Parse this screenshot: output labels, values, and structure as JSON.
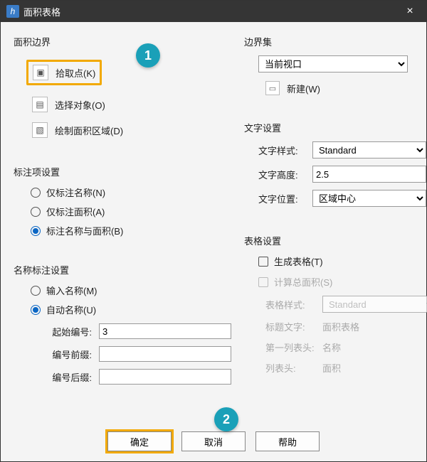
{
  "title": "面积表格",
  "callouts": {
    "one": "1",
    "two": "2"
  },
  "left": {
    "boundary": {
      "title": "面积边界",
      "pick_point": "拾取点(K)",
      "select_obj": "选择对象(O)",
      "draw_region": "绘制面积区域(D)"
    },
    "annot_item": {
      "title": "标注项设置",
      "only_name": "仅标注名称(N)",
      "only_area": "仅标注面积(A)",
      "both": "标注名称与面积(B)"
    },
    "name_annot": {
      "title": "名称标注设置",
      "input_name": "输入名称(M)",
      "auto_name": "自动名称(U)",
      "start_no_label": "起始编号:",
      "start_no_value": "3",
      "prefix_label": "编号前缀:",
      "prefix_value": "",
      "suffix_label": "编号后缀:",
      "suffix_value": ""
    }
  },
  "right": {
    "bset": {
      "title": "边界集",
      "current_viewport": "当前视口",
      "new_btn": "新建(W)"
    },
    "text": {
      "title": "文字设置",
      "style_label": "文字样式:",
      "style_value": "Standard",
      "height_label": "文字高度:",
      "height_value": "2.5",
      "pos_label": "文字位置:",
      "pos_value": "区域中心"
    },
    "table": {
      "title": "表格设置",
      "gen_table": "生成表格(T)",
      "calc_total": "计算总面积(S)",
      "style_label": "表格样式:",
      "style_value": "Standard",
      "title_label": "标题文字:",
      "title_value": "面积表格",
      "col1_label": "第一列表头:",
      "col1_value": "名称",
      "col2_label_partial": "列表头:",
      "col2_value": "面积"
    }
  },
  "footer": {
    "ok": "确定",
    "cancel": "取消",
    "help": "帮助"
  }
}
